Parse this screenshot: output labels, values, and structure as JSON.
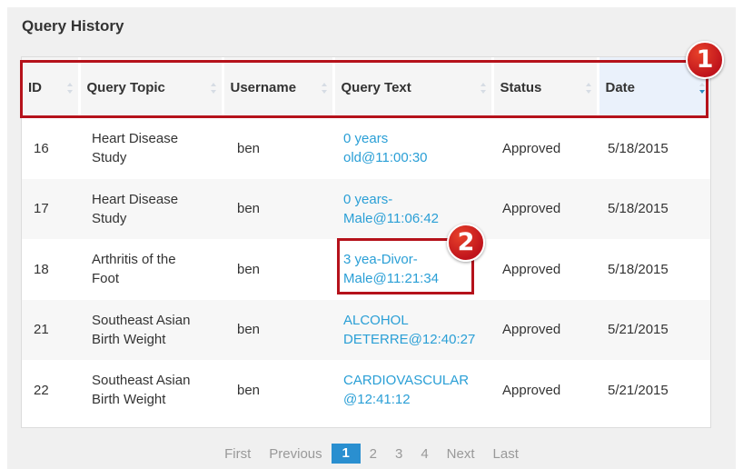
{
  "title": "Query History",
  "columns": [
    "ID",
    "Query Topic",
    "Username",
    "Query Text",
    "Status",
    "Date"
  ],
  "rows": [
    {
      "id": "16",
      "topic": "Heart Disease\nStudy",
      "user": "ben",
      "text": "0 years\nold@11:00:30",
      "status": "Approved",
      "date": "5/18/2015"
    },
    {
      "id": "17",
      "topic": "Heart Disease\nStudy",
      "user": "ben",
      "text": "0 years-\nMale@11:06:42",
      "status": "Approved",
      "date": "5/18/2015"
    },
    {
      "id": "18",
      "topic": "Arthritis of the\nFoot",
      "user": "ben",
      "text": "3 yea-Divor-\nMale@11:21:34",
      "status": "Approved",
      "date": "5/18/2015"
    },
    {
      "id": "21",
      "topic": "Southeast Asian\nBirth Weight",
      "user": "ben",
      "text": "ALCOHOL\nDETERRE@12:40:27",
      "status": "Approved",
      "date": "5/21/2015"
    },
    {
      "id": "22",
      "topic": "Southeast Asian\nBirth Weight",
      "user": "ben",
      "text": "CARDIOVASCULAR\n@12:41:12",
      "status": "Approved",
      "date": "5/21/2015"
    }
  ],
  "pagination": {
    "first": "First",
    "previous": "Previous",
    "pages": [
      "1",
      "2",
      "3",
      "4"
    ],
    "current": "1",
    "next": "Next",
    "last": "Last"
  },
  "markers": [
    "1",
    "2"
  ],
  "colors": {
    "accent": "#2a8fd0",
    "link": "#2a9fd6",
    "highlight": "#b5121b"
  }
}
